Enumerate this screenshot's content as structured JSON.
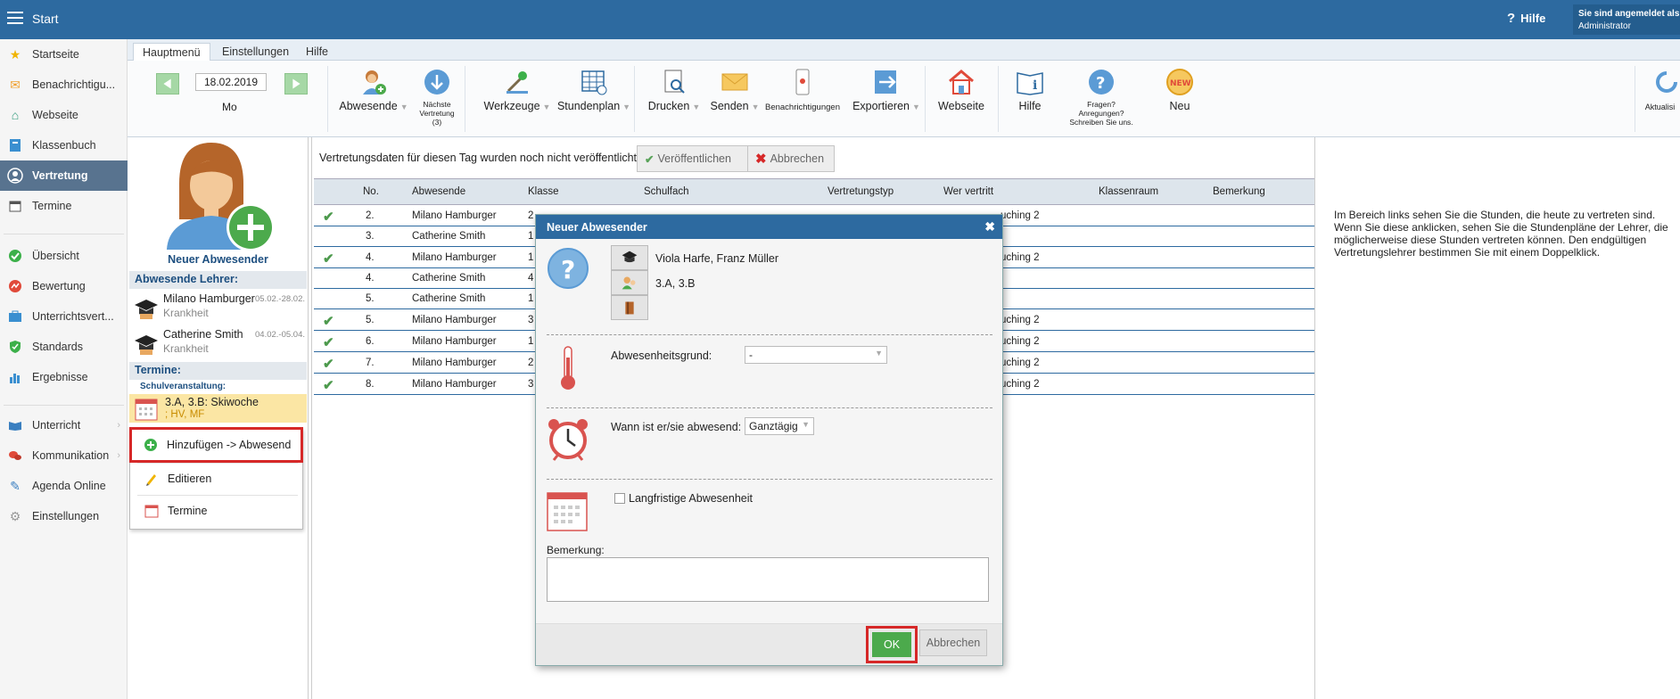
{
  "topbar": {
    "title": "Start",
    "help_label": "Hilfe",
    "login_line1": "Sie sind angemeldet als",
    "login_line2": "Administrator",
    "colors": {
      "bar": "#2d6aa0"
    }
  },
  "sidebar": {
    "items": [
      {
        "label": "Startseite",
        "icon": "star-icon"
      },
      {
        "label": "Benachrichtigu...",
        "icon": "envelope-icon"
      },
      {
        "label": "Webseite",
        "icon": "home-icon"
      },
      {
        "label": "Klassenbuch",
        "icon": "book-icon"
      },
      {
        "label": "Vertretung",
        "icon": "person-icon",
        "active": true
      },
      {
        "label": "Termine",
        "icon": "calendar-icon"
      },
      {
        "label": "Übersicht",
        "icon": "check-circle-icon"
      },
      {
        "label": "Bewertung",
        "icon": "chart-icon"
      },
      {
        "label": "Unterrichtsvert...",
        "icon": "briefcase-icon"
      },
      {
        "label": "Standards",
        "icon": "shield-icon"
      },
      {
        "label": "Ergebnisse",
        "icon": "bar-chart-icon"
      },
      {
        "label": "Unterricht",
        "icon": "open-book-icon"
      },
      {
        "label": "Kommunikation",
        "icon": "chat-icon"
      },
      {
        "label": "Agenda Online",
        "icon": "pen-icon"
      },
      {
        "label": "Einstellungen",
        "icon": "gear-icon"
      }
    ]
  },
  "ribbon_tabs": [
    "Hauptmenü",
    "Einstellungen",
    "Hilfe"
  ],
  "ribbon": {
    "date": "18.02.2019",
    "day": "Mo",
    "buttons": {
      "absent": "Abwesende",
      "next_1": "Nächste",
      "next_2": "Vertretung",
      "next_3": "(3)",
      "tools": "Werkzeuge",
      "timetable": "Stundenplan",
      "print": "Drucken",
      "send": "Senden",
      "notify": "Benachrichtigungen",
      "export": "Exportieren",
      "website": "Webseite",
      "help": "Hilfe",
      "q1": "Fragen?",
      "q2": "Anregungen?",
      "q3": "Schreiben Sie uns.",
      "new": "Neu",
      "new_badge": "NEW",
      "refresh": "Aktualisi"
    }
  },
  "left_panel": {
    "new_absent": "Neuer Abwesender",
    "absent_teachers_heading": "Abwesende Lehrer:",
    "teachers": [
      {
        "name": "Milano Hamburger",
        "reason": "Krankheit",
        "dates": "05.02.-28.02."
      },
      {
        "name": "Catherine Smith",
        "reason": "Krankheit",
        "dates": "04.02.-05.04."
      }
    ],
    "events_heading": "Termine:",
    "event_category": "Schulveranstaltung:",
    "event_title": "3.A, 3.B: Skiwoche",
    "event_sub": "; HV, MF"
  },
  "context_menu": {
    "items": [
      "Hinzufügen -> Abwesend",
      "Editieren",
      "Termine"
    ]
  },
  "main": {
    "notice": "Vertretungsdaten für diesen Tag wurden noch nicht veröffentlicht.",
    "publish": "Veröffentlichen",
    "cancel": "Abbrechen",
    "columns": [
      "No.",
      "Abwesende",
      "Klasse",
      "Schulfach",
      "Vertretungstyp",
      "Wer vertritt",
      "Klassenraum",
      "Bemerkung"
    ],
    "rows": [
      {
        "check": true,
        "no": "2.",
        "absent": "Milano Hamburger",
        "klasse": "2",
        "typ": "uching 2"
      },
      {
        "check": false,
        "no": "3.",
        "absent": "Catherine Smith",
        "klasse": "1",
        "typ": ""
      },
      {
        "check": true,
        "no": "4.",
        "absent": "Milano Hamburger",
        "klasse": "1",
        "typ": "uching 2"
      },
      {
        "check": false,
        "no": "4.",
        "absent": "Catherine Smith",
        "klasse": "4",
        "typ": ""
      },
      {
        "check": false,
        "no": "5.",
        "absent": "Catherine Smith",
        "klasse": "1",
        "typ": ""
      },
      {
        "check": true,
        "no": "5.",
        "absent": "Milano Hamburger",
        "klasse": "3",
        "typ": "uching 2"
      },
      {
        "check": true,
        "no": "6.",
        "absent": "Milano Hamburger",
        "klasse": "1",
        "typ": "uching 2"
      },
      {
        "check": true,
        "no": "7.",
        "absent": "Milano Hamburger",
        "klasse": "2",
        "typ": "uching 2"
      },
      {
        "check": true,
        "no": "8.",
        "absent": "Milano Hamburger",
        "klasse": "3",
        "typ": "uching 2"
      }
    ]
  },
  "right_panel": {
    "text": "Im Bereich links sehen Sie die Stunden, die heute zu vertreten sind. Wenn Sie diese anklicken, sehen Sie die Stundenpläne der Lehrer, die möglicherweise diese Stunden vertreten können. Den endgültigen Vertretungslehrer bestimmen Sie mit einem Doppelklick."
  },
  "modal": {
    "title": "Neuer Abwesender",
    "teachers": "Viola Harfe, Franz Müller",
    "classes": "3.A, 3.B",
    "reason_label": "Abwesenheitsgrund:",
    "reason_value": "-",
    "when_label": "Wann ist er/sie abwesend:",
    "when_value": "Ganztägig",
    "long_term_label": "Langfristige Abwesenheit",
    "remark_label": "Bemerkung:",
    "ok": "OK",
    "cancel": "Abbrechen"
  }
}
